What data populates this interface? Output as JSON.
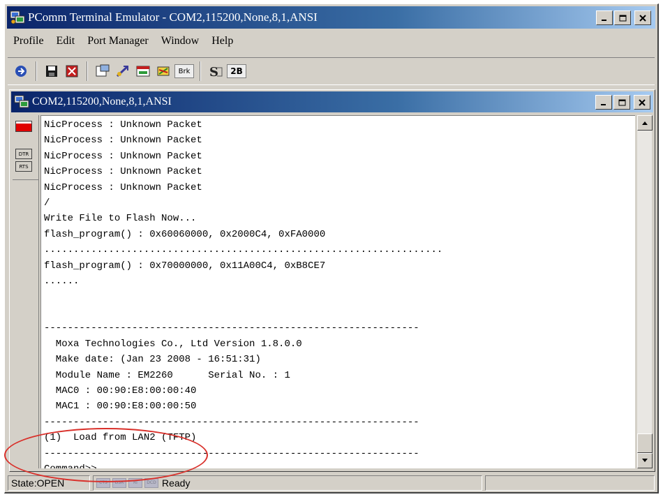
{
  "window": {
    "title": "PComm Terminal Emulator - COM2,115200,None,8,1,ANSI"
  },
  "menu": {
    "items": [
      "Profile",
      "Edit",
      "Port Manager",
      "Window",
      "Help"
    ]
  },
  "toolbar": {
    "brk_label": "Brk",
    "twob_label": "2B"
  },
  "child_window": {
    "title": "COM2,115200,None,8,1,ANSI"
  },
  "left_panel": {
    "dtr_label": "DTR",
    "rts_label": "RTS"
  },
  "terminal": {
    "lines": [
      "NicProcess : Unknown Packet",
      "NicProcess : Unknown Packet",
      "NicProcess : Unknown Packet",
      "NicProcess : Unknown Packet",
      "NicProcess : Unknown Packet",
      "/",
      "Write File to Flash Now...",
      "flash_program() : 0x60060000, 0x2000C4, 0xFA0000",
      "....................................................................",
      "flash_program() : 0x70000000, 0x11A00C4, 0xB8CE7",
      "......",
      "",
      "",
      "----------------------------------------------------------------",
      "  Moxa Technologies Co., Ltd Version 1.8.0.0",
      "  Make date: (Jan 23 2008 - 16:51:31)",
      "  Module Name : EM2260      Serial No. : 1",
      "  MAC0 : 00:90:E8:00:00:40",
      "  MAC1 : 00:90:E8:00:00:50",
      "----------------------------------------------------------------",
      "(1)  Load from LAN2 (TFTP)",
      "----------------------------------------------------------------",
      "Command>>"
    ]
  },
  "statusbar": {
    "state": "State:OPEN",
    "indicators": [
      "CTS",
      "DSR",
      "RI",
      "DCD"
    ],
    "ready": "Ready"
  },
  "colors": {
    "title_active": "#0a246a",
    "chrome": "#d4d0c8",
    "annotation": "#d9302a",
    "led": "#e00000"
  }
}
